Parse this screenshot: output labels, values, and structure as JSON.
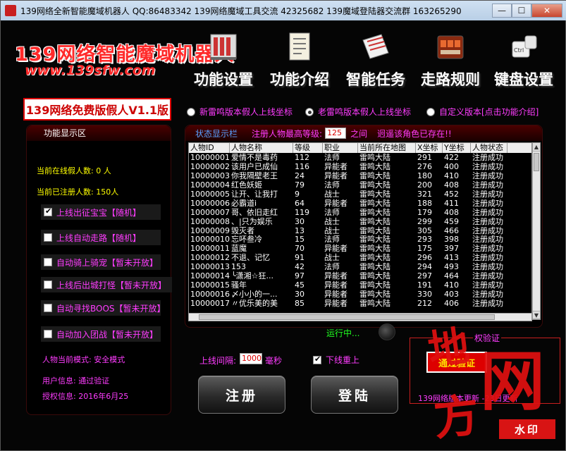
{
  "window": {
    "title": "139网络全新智能魔域机器人   QQ:86483342   139网络魔域工具交流 42325682   139魔域登陆器交流群 163265290",
    "minimize": "—",
    "maximize": "☐",
    "close": "✕"
  },
  "logo": {
    "title": "139网络智能魔域机器人",
    "url": "www.139sfw.com"
  },
  "nav": [
    {
      "label": "功能设置",
      "icon": "server-icon"
    },
    {
      "label": "功能介绍",
      "icon": "document-icon"
    },
    {
      "label": "智能任务",
      "icon": "notebook-icon"
    },
    {
      "label": "走路规则",
      "icon": "calculator-icon"
    },
    {
      "label": "键盘设置",
      "icon": "keyboard-icon"
    }
  ],
  "version_badge": "139网络免费版假人V1.1版",
  "radios": [
    {
      "label": "新雷鸣版本假人上线坐标",
      "checked": false
    },
    {
      "label": "老雷鸣版本假人上线坐标",
      "checked": true
    },
    {
      "label": "自定义版本[点击功能介绍]",
      "checked": false
    }
  ],
  "left_panel": {
    "header": "功能显示区",
    "online_count": "当前在线假人数: 0 人",
    "registered_count": "当前已注册人数: 150人",
    "options": [
      {
        "label": "上线出征宝宝【随机】",
        "checked": true
      },
      {
        "label": "上线自动走路【随机】",
        "checked": false
      },
      {
        "label": "自动骑上骑宠【暂未开放】",
        "checked": false
      },
      {
        "label": "上线后出城打怪【暂未开放】",
        "checked": false
      },
      {
        "label": "自动寻找BOOS【暂未开放】",
        "checked": false
      },
      {
        "label": "自动加入团战【暂未开放】",
        "checked": false
      }
    ],
    "mode": "人物当前模式: 安全模式",
    "user_info": "用户信息: 通过验证",
    "auth_info": "授权信息: 2016年6月25"
  },
  "grid": {
    "status_label": "状态显示栏",
    "max_level_label": "注册人物最高等级:",
    "max_level_value": "125",
    "between": "之间",
    "exists_msg": "迥遥该角色已存在!!",
    "columns": [
      "人物ID",
      "人物名称",
      "等级",
      "职业",
      "当前所在地图",
      "X坐标",
      "Y坐标",
      "人物状态"
    ],
    "rows": [
      [
        "10000001",
        "爱情不是毒药",
        "112",
        "法师",
        "雷鸣大陆",
        "291",
        "422",
        "注册成功"
      ],
      [
        "10000002",
        "该用户已成仙",
        "116",
        "异能者",
        "雷鸣大陆",
        "276",
        "400",
        "注册成功"
      ],
      [
        "10000003",
        "你我隔壁老王",
        "24",
        "异能者",
        "雷鸣大陆",
        "180",
        "410",
        "注册成功"
      ],
      [
        "10000004",
        "红色妖姬",
        "79",
        "法师",
        "雷鸣大陆",
        "200",
        "408",
        "注册成功"
      ],
      [
        "10000005",
        "让开、让我打",
        "9",
        "战士",
        "雷鸣大陆",
        "321",
        "452",
        "注册成功"
      ],
      [
        "10000006",
        "必霸道i",
        "64",
        "异能者",
        "雷鸣大陆",
        "188",
        "411",
        "注册成功"
      ],
      [
        "10000007",
        "哥、依旧走红",
        "119",
        "法师",
        "雷鸣大陆",
        "179",
        "408",
        "注册成功"
      ],
      [
        "10000008",
        "、|只为娱乐",
        "30",
        "战士",
        "雷鸣大陆",
        "299",
        "459",
        "注册成功"
      ],
      [
        "10000009",
        "毁灭者",
        "13",
        "战士",
        "雷鸣大陆",
        "305",
        "466",
        "注册成功"
      ],
      [
        "10000010",
        "忘吥叁冷",
        "15",
        "法师",
        "雷鸣大陆",
        "293",
        "398",
        "注册成功"
      ],
      [
        "10000011",
        "蓝魔",
        "70",
        "异能者",
        "雷鸣大陆",
        "175",
        "397",
        "注册成功"
      ],
      [
        "10000012",
        "不退、记忆",
        "91",
        "战士",
        "雷鸣大陆",
        "296",
        "413",
        "注册成功"
      ],
      [
        "10000013",
        "153",
        "42",
        "法师",
        "雷鸣大陆",
        "294",
        "493",
        "注册成功"
      ],
      [
        "10000014",
        "╰潇湘☆狂...",
        "97",
        "异能者",
        "雷鸣大陆",
        "297",
        "464",
        "注册成功"
      ],
      [
        "10000015",
        "骚年",
        "45",
        "异能者",
        "雷鸣大陆",
        "191",
        "410",
        "注册成功"
      ],
      [
        "10000016",
        "〆小小的一...",
        "30",
        "异能者",
        "雷鸣大陆",
        "330",
        "403",
        "注册成功"
      ],
      [
        "10000017",
        "〃优乐美的美",
        "85",
        "异能者",
        "雷鸣大陆",
        "212",
        "406",
        "注册成功"
      ]
    ]
  },
  "status": {
    "running": "运行中..."
  },
  "controls": {
    "interval_label": "上线间隔:",
    "interval_value": "1000",
    "interval_unit": "毫秒",
    "reconnect_label": "下线重上",
    "reconnect_checked": true,
    "register_button": "注册",
    "login_button": "登陆"
  },
  "auth": {
    "title": "权验证",
    "button": "通过验证",
    "info": "139网络版本更新  -23日更新"
  },
  "watermark": {
    "chars": [
      "地",
      "网",
      "方"
    ],
    "stamp": "水印"
  }
}
